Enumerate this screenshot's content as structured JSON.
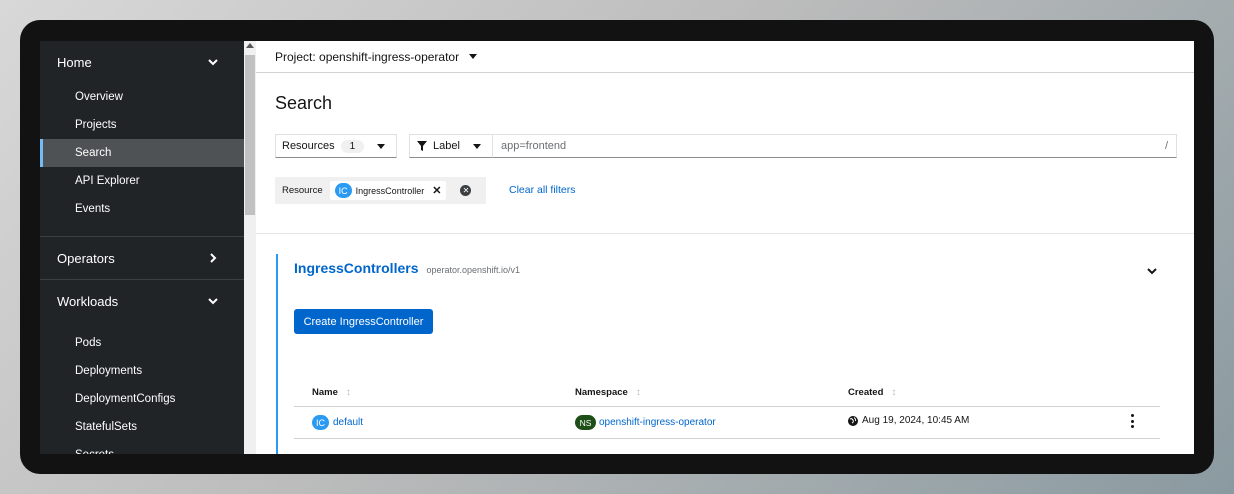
{
  "sidebar": {
    "home": {
      "label": "Home",
      "items": [
        {
          "label": "Overview"
        },
        {
          "label": "Projects"
        },
        {
          "label": "Search",
          "active": true
        },
        {
          "label": "API Explorer"
        },
        {
          "label": "Events"
        }
      ]
    },
    "operators": {
      "label": "Operators"
    },
    "workloads": {
      "label": "Workloads",
      "items": [
        {
          "label": "Pods"
        },
        {
          "label": "Deployments"
        },
        {
          "label": "DeploymentConfigs"
        },
        {
          "label": "StatefulSets"
        },
        {
          "label": "Secrets"
        }
      ]
    }
  },
  "project_bar": {
    "label": "Project: openshift-ingress-operator"
  },
  "page": {
    "title": "Search"
  },
  "filters": {
    "resources_label": "Resources",
    "resources_count": "1",
    "label_toggle": "Label",
    "label_input_value": "app=frontend",
    "shortcut_hint": "/",
    "chip_group_label": "Resource",
    "chip_badge": "IC",
    "chip_label": "IngressController",
    "clear_all": "Clear all filters"
  },
  "card": {
    "title": "IngressControllers",
    "api_version": "operator.openshift.io/v1",
    "create_button": "Create IngressController",
    "columns": [
      "Name",
      "Namespace",
      "Created"
    ],
    "rows": [
      {
        "name_badge": "IC",
        "name": "default",
        "ns_badge": "NS",
        "namespace": "openshift-ingress-operator",
        "created": "Aug 19, 2024, 10:45 AM"
      }
    ]
  },
  "colors": {
    "sidebar_bg": "#212427",
    "active_nav_bg": "#4f5255",
    "active_nav_accent": "#73bcf7",
    "link_blue": "#0066cc",
    "primary_button": "#0066cc",
    "ic_badge": "#2b9af3",
    "ns_badge": "#1e4f18"
  }
}
